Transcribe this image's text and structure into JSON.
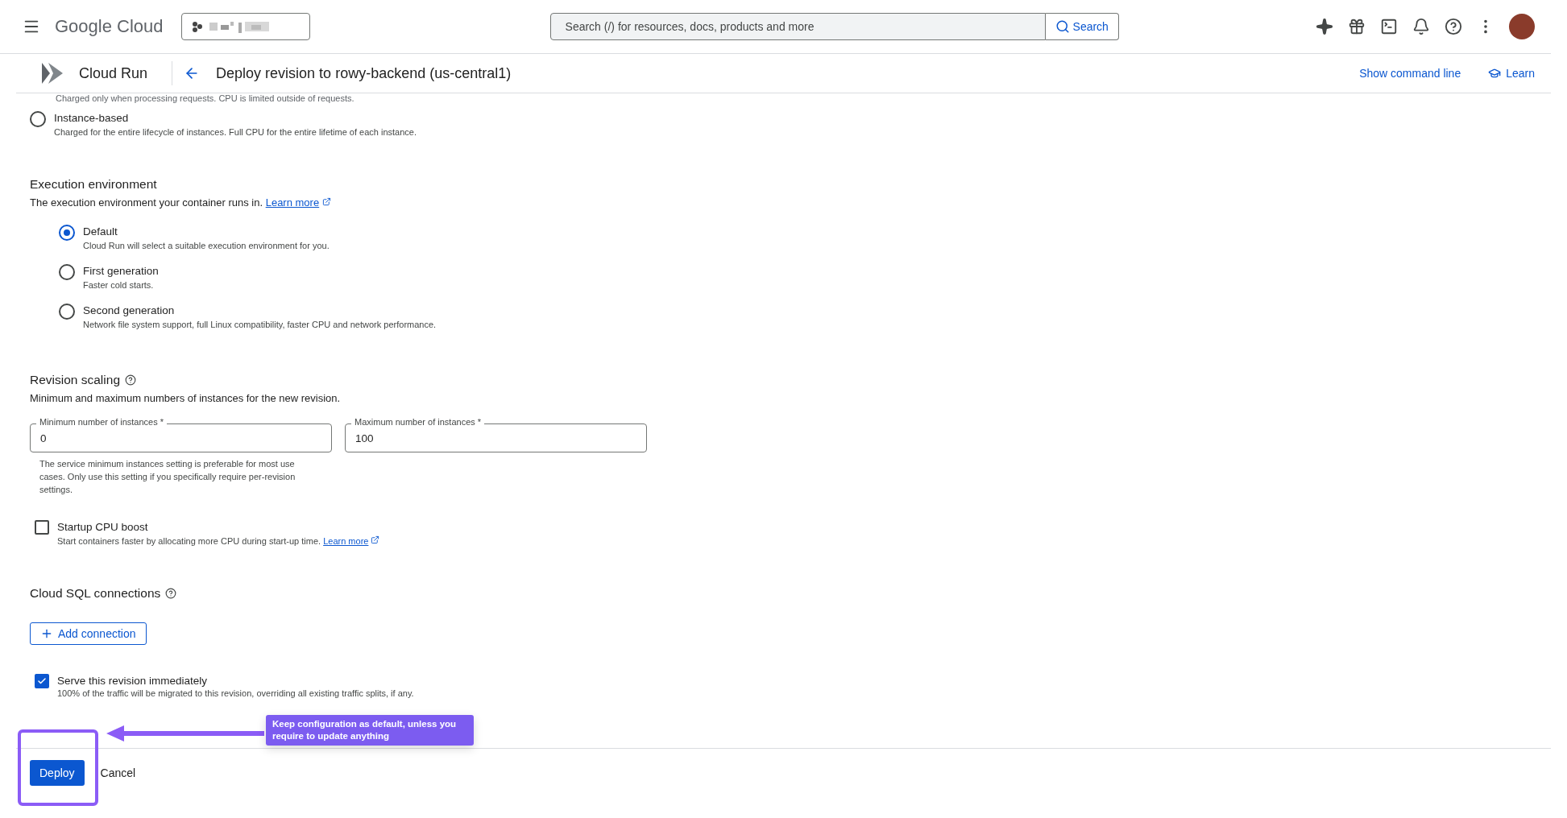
{
  "top_bar": {
    "brand": "Google Cloud",
    "search": {
      "placeholder": "Search (/) for resources, docs, products and more",
      "button": "Search"
    }
  },
  "page_header": {
    "product": "Cloud Run",
    "title": "Deploy revision to rowy-backend (us-central1)",
    "actions": [
      "Show command line",
      "Learn"
    ]
  },
  "billing": {
    "cut_description": "Charged only when processing requests. CPU is limited outside of requests.",
    "option": {
      "label": "Instance-based",
      "description": "Charged for the entire lifecycle of instances. Full CPU for the entire lifetime of each instance.",
      "selected": false
    }
  },
  "execution_environment": {
    "heading": "Execution environment",
    "description": "The execution environment your container runs in.",
    "link": "Learn more",
    "options": [
      {
        "label": "Default",
        "description": "Cloud Run will select a suitable execution environment for you.",
        "selected": true
      },
      {
        "label": "First generation",
        "description": "Faster cold starts.",
        "selected": false
      },
      {
        "label": "Second generation",
        "description": "Network file system support, full Linux compatibility, faster CPU and network performance.",
        "selected": false
      }
    ]
  },
  "revision_scaling": {
    "heading": "Revision scaling",
    "description": "Minimum and maximum numbers of instances for the new revision.",
    "fields": [
      {
        "label": "Minimum number of instances *",
        "value": "0",
        "hint": "The service minimum instances setting is preferable for most use cases. Only use this setting if you specifically require per-revision settings."
      },
      {
        "label": "Maximum number of instances *",
        "value": "100"
      }
    ]
  },
  "startup_boost": {
    "label": "Startup CPU boost",
    "description": "Start containers faster by allocating more CPU during start-up time.",
    "link": "Learn more",
    "checked": false
  },
  "cloud_sql": {
    "heading": "Cloud SQL connections",
    "button": "Add connection"
  },
  "serve": {
    "label": "Serve this revision immediately",
    "description": "100% of the traffic will be migrated to this revision, overriding all existing traffic splits, if any.",
    "checked": true
  },
  "footer": {
    "primary": "Deploy",
    "secondary": "Cancel"
  },
  "annotation": {
    "note": "Keep configuration as default, unless you require to update anything"
  }
}
